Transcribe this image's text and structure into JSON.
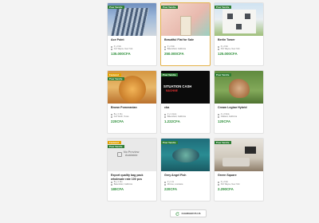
{
  "listings": [
    {
      "title": "Ace Point",
      "tags": [
        "Pour Vendre"
      ],
      "tag_colors": [
        "#2d7d33"
      ],
      "meta": [
        "6 y 2 Mo",
        "Fort Wayne, New York"
      ],
      "price": "135.000CFA",
      "image": "building"
    },
    {
      "title": "Beautiful Flat for Sale",
      "tags": [
        "Pour Vendre"
      ],
      "tag_colors": [
        "#2d7d33"
      ],
      "meta": [
        "6 y 2 Mo",
        "Bakersfield, California"
      ],
      "price": "250.000CFA",
      "image": "house-pastel"
    },
    {
      "title": "Berlin Tower",
      "tags": [
        "Pour Vendre"
      ],
      "tag_colors": [
        "#2d7d33"
      ],
      "meta": [
        "6 y 2 Mo",
        "Port Wayne, New York"
      ],
      "price": "125.000CFA",
      "image": "house-white"
    },
    {
      "title": "Brown Pomeranian",
      "tags": [
        "Featured",
        "Pour Vendre"
      ],
      "tag_colors": [
        "#e3a100",
        "#2d7d33"
      ],
      "meta": [
        "Bu y 1 Mo",
        "Fort Worth, Texas"
      ],
      "price": "220CFA",
      "image": "dog"
    },
    {
      "title": "cba",
      "tags": [
        "Pour Vendre"
      ],
      "tag_colors": [
        "#2d7d33"
      ],
      "meta": [
        "4 y 4 Jours",
        "Bakersfield, California"
      ],
      "price": "1.222CFA",
      "image": "dark"
    },
    {
      "title": "Cream Legbar Hybrid",
      "tags": [
        "Pour Vendre"
      ],
      "tag_colors": [
        "#2d7d33"
      ],
      "meta": [
        "4 y 2 Mois",
        "Oakland, California"
      ],
      "price": "120CFA",
      "image": "hen"
    },
    {
      "title": "Export quality bag pack wholesale rate 100 pcs",
      "tags": [
        "Featured",
        "Pour Vendre"
      ],
      "tag_colors": [
        "#e3a100",
        "#2d7d33"
      ],
      "meta": [
        "Bu y 1 Mo",
        "Bakersfield, California"
      ],
      "price": "180CFA",
      "image": "noprev"
    },
    {
      "title": "Grey Angel Fish",
      "tags": [
        "Pour Vendre"
      ],
      "tag_colors": [
        "#2d7d33"
      ],
      "meta": [
        "4 y 4 Jo",
        "Monroe, Louisiana"
      ],
      "price": "220CFA",
      "image": "fish"
    },
    {
      "title": "Green Square",
      "tags": [
        "Pour Vendre"
      ],
      "tag_colors": [
        "#2d7d33"
      ],
      "meta": [
        "6 y 2 Mo",
        "Port Wayne, New York"
      ],
      "price": "2.290CFA",
      "image": "living"
    }
  ],
  "image_text": {
    "dark_line1": "SITUATION CASH",
    "dark_line2": "MACHINE",
    "no_preview": "No Preview\nAvailable"
  },
  "load_more": {
    "label": "CHARGER PLUS",
    "icon": "refresh-icon"
  },
  "colors": {
    "price": "#2d8f3a",
    "tag_green": "#2d7d33",
    "tag_gold": "#e3a100",
    "featured_border": "#e4b24b"
  }
}
